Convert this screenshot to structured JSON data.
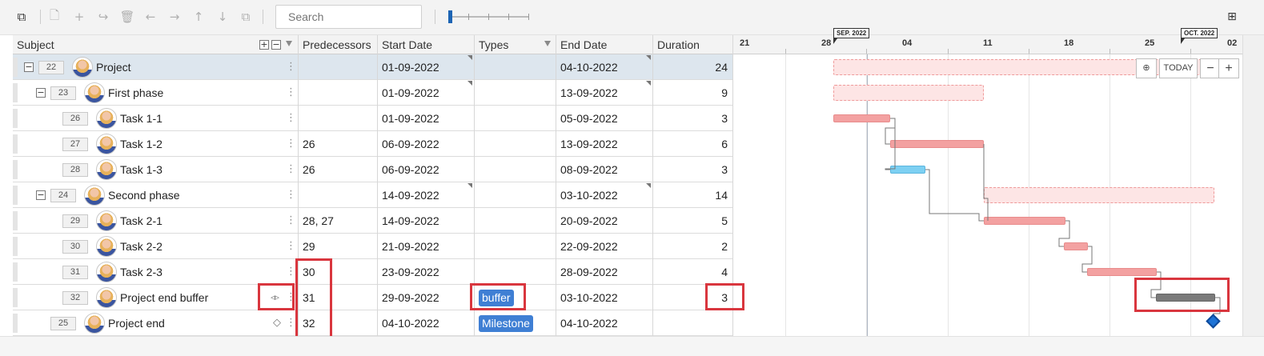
{
  "toolbar": {
    "search_placeholder": "Search",
    "icons": [
      "layout-icon",
      "new-file-icon",
      "add-icon",
      "indent-icon",
      "delete-icon",
      "undo-icon",
      "redo-icon",
      "move-up-icon",
      "move-down-icon",
      "copy-icon",
      "apps-add-icon"
    ]
  },
  "columns": {
    "subject": "Subject",
    "predecessors": "Predecessors",
    "start_date": "Start Date",
    "types": "Types",
    "end_date": "End Date",
    "duration": "Duration"
  },
  "timeline": {
    "days": [
      "21",
      "28",
      "04",
      "11",
      "18",
      "25",
      "02"
    ],
    "month_flags": [
      "SEP. 2022",
      "OCT. 2022"
    ],
    "today_label": "TODAY",
    "zoom_out": "−",
    "zoom_in": "+"
  },
  "rows": [
    {
      "id": "22",
      "name": "Project",
      "pred": "",
      "start": "01-09-2022",
      "type": "",
      "end": "04-10-2022",
      "duration": "24"
    },
    {
      "id": "23",
      "name": "First phase",
      "pred": "",
      "start": "01-09-2022",
      "type": "",
      "end": "13-09-2022",
      "duration": "9"
    },
    {
      "id": "26",
      "name": "Task 1-1",
      "pred": "",
      "start": "01-09-2022",
      "type": "",
      "end": "05-09-2022",
      "duration": "3"
    },
    {
      "id": "27",
      "name": "Task 1-2",
      "pred": "26",
      "start": "06-09-2022",
      "type": "",
      "end": "13-09-2022",
      "duration": "6"
    },
    {
      "id": "28",
      "name": "Task 1-3",
      "pred": "26",
      "start": "06-09-2022",
      "type": "",
      "end": "08-09-2022",
      "duration": "3"
    },
    {
      "id": "24",
      "name": "Second phase",
      "pred": "",
      "start": "14-09-2022",
      "type": "",
      "end": "03-10-2022",
      "duration": "14"
    },
    {
      "id": "29",
      "name": "Task 2-1",
      "pred": "28, 27",
      "start": "14-09-2022",
      "type": "",
      "end": "20-09-2022",
      "duration": "5"
    },
    {
      "id": "30",
      "name": "Task 2-2",
      "pred": "29",
      "start": "21-09-2022",
      "type": "",
      "end": "22-09-2022",
      "duration": "2"
    },
    {
      "id": "31",
      "name": "Task 2-3",
      "pred": "30",
      "start": "23-09-2022",
      "type": "",
      "end": "28-09-2022",
      "duration": "4"
    },
    {
      "id": "32",
      "name": "Project end buffer",
      "pred": "31",
      "start": "29-09-2022",
      "type": "buffer",
      "end": "03-10-2022",
      "duration": "3"
    },
    {
      "id": "25",
      "name": "Project end",
      "pred": "32",
      "start": "04-10-2022",
      "type": "Milestone",
      "end": "04-10-2022",
      "duration": ""
    }
  ],
  "colors": {
    "accent": "#3f7fd4",
    "highlight": "#d9363e",
    "task_bar": "#f3a1a1",
    "buffer_bar": "#7a7a7a",
    "critical_light": "#7dd0f2"
  }
}
